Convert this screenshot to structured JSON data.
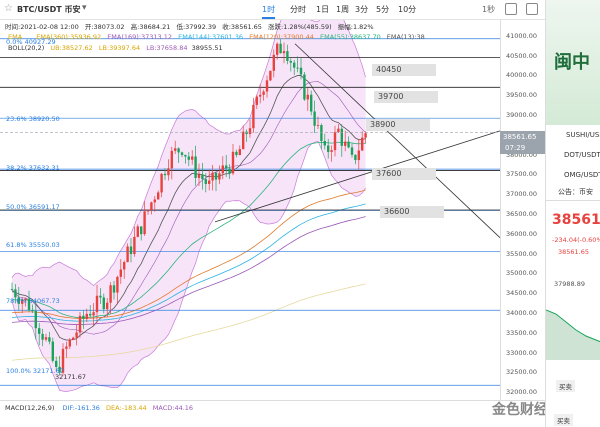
{
  "toolbar": {
    "symbol": "BTC/USDT 币安",
    "intervals": [
      "1时",
      "分时",
      "1日",
      "1周",
      "5分",
      "1月",
      "3分",
      "5分",
      "10分"
    ],
    "active_interval": "1时",
    "right_label": "1秒"
  },
  "info_bar": {
    "time": "时间:2021-02-08 12:00",
    "open": "开:38073.02",
    "high": "高:38684.21",
    "low": "低:37992.39",
    "close": "收:38561.65",
    "change": "涨跌:1.28%(485.59)",
    "amplitude": "振幅:1.82%"
  },
  "ma_bar": {
    "ema1": "EMA",
    "ema360": "EMA(360):35936.92",
    "ema169": "EMA(169):37313.12",
    "ema144": "EMA(144):37601.36",
    "ema120": "EMA(120):37900.44",
    "ema55": "EMA(55):38637.70",
    "ema13": "EMA(13):38"
  },
  "boll_bar": {
    "label": "BOLL(20,2)",
    "ub": "UB:38527.62",
    "lb": "LB:39397.64",
    "mid": "LB:37658.84",
    "last": "38955.51"
  },
  "fib_levels": [
    {
      "label": "0.0% 40927.29",
      "price": 40927
    },
    {
      "label": "23.6% 38920.50",
      "price": 38920
    },
    {
      "label": "38.2% 37632.31",
      "price": 37632
    },
    {
      "label": "50.0% 36591.17",
      "price": 36591
    },
    {
      "label": "61.8% 35550.03",
      "price": 35550
    },
    {
      "label": "78.6% 34067.73",
      "price": 34068
    },
    {
      "label": "100.0% 32171.67",
      "price": 32172
    }
  ],
  "low_label": "32171.67",
  "price_tags": [
    "40450",
    "39700",
    "38900",
    "37600",
    "36600"
  ],
  "y_ticks": [
    "41000.00",
    "40500.00",
    "40000.00",
    "39500.00",
    "39000.00",
    "38500.00",
    "38000.00",
    "37500.00",
    "37000.00",
    "36500.00",
    "36000.00",
    "35500.00",
    "35000.00",
    "34500.00",
    "34000.00",
    "33500.00",
    "33000.00",
    "32500.00",
    "32000.00"
  ],
  "current_price": "38561.65",
  "countdown": "07:29",
  "macd": {
    "label": "MACD(12,26,9)",
    "dif": "DIF:-161.36",
    "dea": "DEA:-183.44",
    "macd": "MACD:44.16"
  },
  "watermark": "金色财经",
  "right_panel": {
    "banner_text": "闽中",
    "list": [
      "SUSHI/USD",
      "DOT/USDT",
      "OMG/USDT"
    ],
    "announce": "公告：币安",
    "big_price": "38561",
    "change": "-234.04(-0.60%)",
    "price_small": "38561.65",
    "val": "37988.89",
    "btn": "买卖",
    "btn2": "买卖"
  },
  "chart_data": {
    "type": "candlestick",
    "ylim": [
      31800,
      41400
    ]
  },
  "colors": {
    "up": "#e8423f",
    "down": "#19a35a",
    "fib": "#2a7fe0",
    "boll_fill": "#f3d9f7"
  }
}
